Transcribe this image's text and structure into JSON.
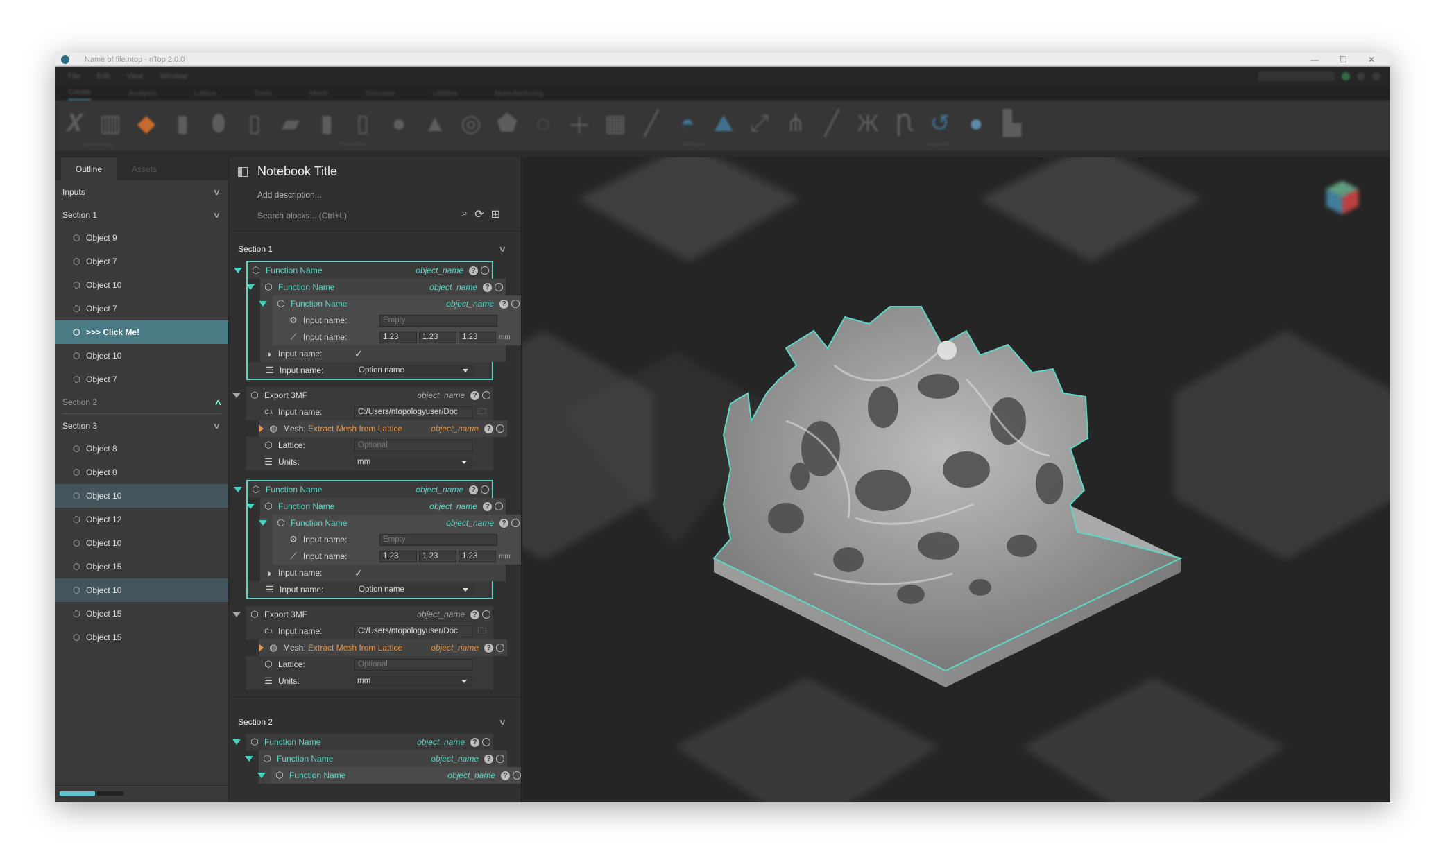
{
  "window": {
    "title": "Name of file.ntop - nTop 2.0.0",
    "controls": [
      "—",
      "☐",
      "✕"
    ]
  },
  "menu": [
    "File",
    "Edit",
    "View",
    "Window"
  ],
  "ribbon_tabs": [
    "Create",
    "Analysis",
    "Lattice",
    "Tools",
    "Mesh",
    "Simulate",
    "Utilities",
    "Manufacturing"
  ],
  "ribbon_groups": [
    "Notebooks",
    "Primitives",
    "Meshes",
    "Implicits"
  ],
  "outline": {
    "tabs": [
      "Outline",
      "Assets"
    ],
    "inputs_label": "Inputs",
    "section1": {
      "label": "Section 1",
      "items": [
        "Object 9",
        "Object 7",
        "Object 10",
        "Object 7",
        ">>> Click Me!",
        "Object 10",
        "Object 7"
      ]
    },
    "section2": {
      "label": "Section 2"
    },
    "section3": {
      "label": "Section 3",
      "items": [
        "Object 8",
        "Object 8",
        "Object 10",
        "Object 12",
        "Object 10",
        "Object 15",
        "Object 10",
        "Object 15",
        "Object 15"
      ]
    },
    "progress": 0.55
  },
  "notebook": {
    "title": "Notebook Title",
    "description": "Add description...",
    "search_placeholder": "Search blocks... (Ctrl+L)",
    "section1_label": "Section 1",
    "section2_label": "Section 2",
    "fn_name": "Function Name",
    "obj_name": "object_name",
    "input_label": "Input name:",
    "empty_placeholder": "Empty",
    "vec": [
      "1.23",
      "1.23",
      "1.23"
    ],
    "unit": "mm",
    "option": "Option name",
    "export": "Export 3MF",
    "path": "C:/Users/ntopologyuser/Doc",
    "path_prefix": "C:\\",
    "mesh_label": "Mesh:",
    "mesh_value": "Extract Mesh from Lattice",
    "lattice_label": "Lattice:",
    "optional": "Optional",
    "units_label": "Units:",
    "units_value": "mm",
    "help": "?"
  },
  "colors": {
    "accent": "#5fd6c4",
    "orange": "#e3954a",
    "selection": "#4a7a84"
  }
}
